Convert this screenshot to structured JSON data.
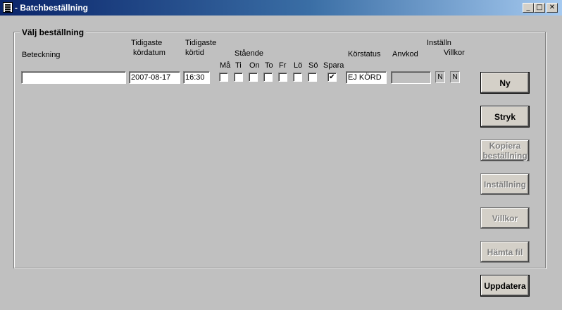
{
  "window": {
    "title": "- Batchbeställning",
    "minimize_glyph": "_",
    "maximize_glyph": "□",
    "close_glyph": "✕"
  },
  "group": {
    "label": "Välj beställning"
  },
  "headers": {
    "beteckning": "Beteckning",
    "tidigaste_kordatum_1": "Tidigaste",
    "tidigaste_kordatum_2": "kördatum",
    "tidigaste_kortid_1": "Tidigaste",
    "tidigaste_kortid_2": "körtid",
    "staende": "Stående",
    "korstatus": "Körstatus",
    "anvkod": "Anvkod",
    "installn": "Inställn",
    "villkor": "Villkor"
  },
  "days": [
    {
      "label": "Må",
      "checked": false
    },
    {
      "label": "Ti",
      "checked": false
    },
    {
      "label": "On",
      "checked": false
    },
    {
      "label": "To",
      "checked": false
    },
    {
      "label": "Fr",
      "checked": false
    },
    {
      "label": "Lö",
      "checked": false
    },
    {
      "label": "Sö",
      "checked": false
    },
    {
      "label": "Spara",
      "checked": true
    }
  ],
  "row": {
    "beteckning": "",
    "kordatum": "2007-08-17",
    "kortid": "16:30",
    "korstatus": "EJ KÖRD",
    "anvkod": "",
    "installn": "N",
    "villkor": "N"
  },
  "buttons": {
    "ny": "Ny",
    "stryk": "Stryk",
    "kopiera_1": "Kopiera",
    "kopiera_2": "beställning",
    "installning": "Inställning",
    "villkor": "Villkor",
    "hamta_fil": "Hämta fil",
    "uppdatera": "Uppdatera"
  },
  "check_glyph": "✔"
}
